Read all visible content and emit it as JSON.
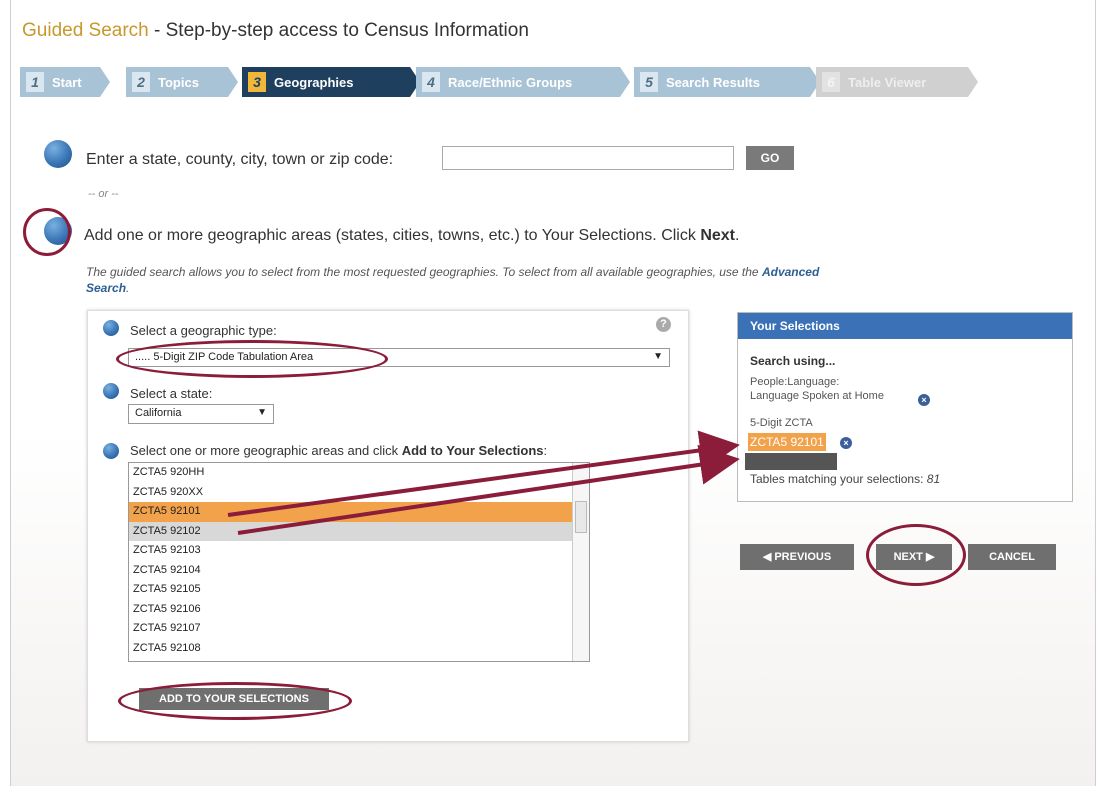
{
  "header": {
    "brand": "Guided Search",
    "subtitle": " - Step-by-step access to Census Information"
  },
  "steps": [
    {
      "num": "1",
      "label": "Start"
    },
    {
      "num": "2",
      "label": "Topics"
    },
    {
      "num": "3",
      "label": "Geographies"
    },
    {
      "num": "4",
      "label": "Race/Ethnic Groups"
    },
    {
      "num": "5",
      "label": "Search Results"
    },
    {
      "num": "6",
      "label": "Table Viewer"
    }
  ],
  "search": {
    "label": "Enter a state, county, city, town or zip code:",
    "value": "",
    "go": "GO"
  },
  "or_text": "-- or --",
  "add_instruction": {
    "text": "Add one or more geographic areas (states, cities, towns, etc.) to Your Selections. Click ",
    "bold": "Next",
    "end": "."
  },
  "note": {
    "text": "The guided search allows you to select from the most requested geographies. To select from all available geographies, use the ",
    "link": "Advanced Search",
    "end": "."
  },
  "geo": {
    "type_label": "Select a geographic type:",
    "type_value": "..... 5-Digit ZIP Code Tabulation Area",
    "state_label": "Select a state:",
    "state_value": "California",
    "areas_label": "Select one or more geographic areas and click ",
    "areas_bold": "Add to Your Selections",
    "areas_end": ":",
    "areas": [
      "ZCTA5 920HH",
      "ZCTA5 920XX",
      "ZCTA5 92101",
      "ZCTA5 92102",
      "ZCTA5 92103",
      "ZCTA5 92104",
      "ZCTA5 92105",
      "ZCTA5 92106",
      "ZCTA5 92107",
      "ZCTA5 92108"
    ],
    "add_button": "ADD TO YOUR SELECTIONS"
  },
  "selections": {
    "title": "Your Selections",
    "search_using": "Search using...",
    "topic_line1": "People:Language:",
    "topic_line2": "Language Spoken at Home",
    "geo_heading": "5-Digit ZCTA",
    "geo_value": "ZCTA5 92101",
    "tables_label": "Tables matching your selections: ",
    "tables_count": "81"
  },
  "nav": {
    "previous": "PREVIOUS",
    "next": "NEXT",
    "cancel": "CANCEL"
  },
  "colors": {
    "brand": "#c8982a",
    "annotation": "#8b1c3a",
    "highlight": "#f2a24a",
    "header_blue": "#3b71b7"
  }
}
